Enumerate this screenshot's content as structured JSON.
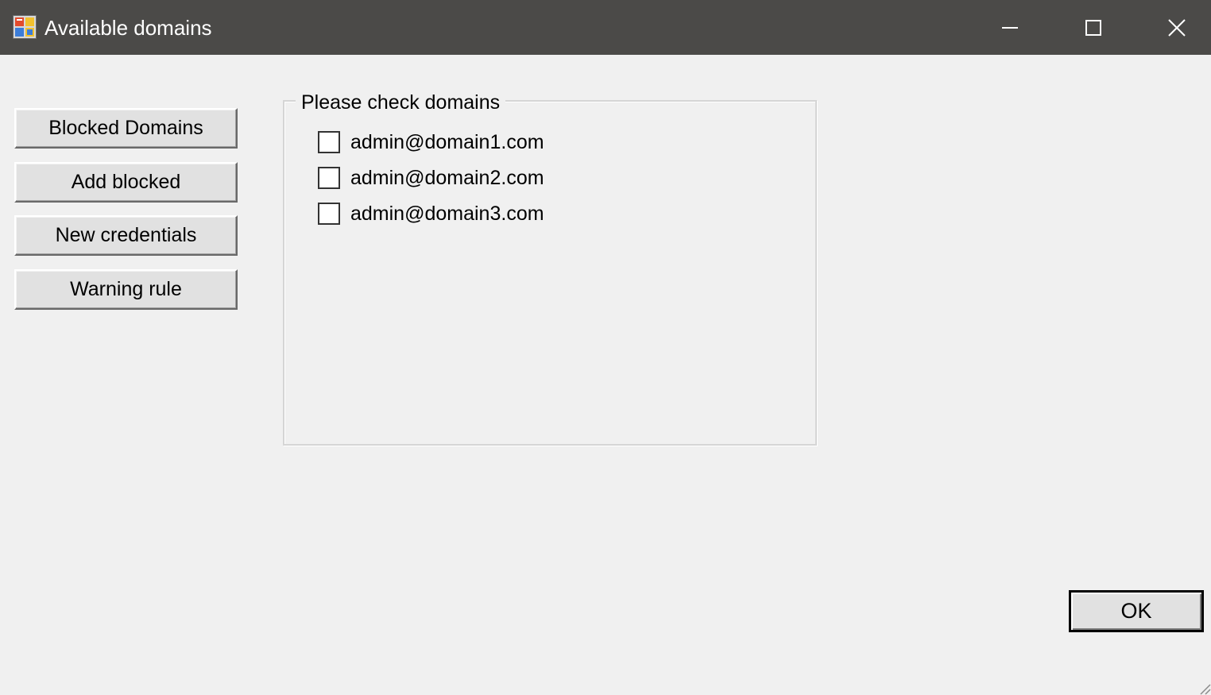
{
  "window": {
    "title": "Available domains"
  },
  "sidebar": {
    "buttons": [
      {
        "label": "Blocked Domains"
      },
      {
        "label": "Add blocked"
      },
      {
        "label": "New credentials"
      },
      {
        "label": "Warning rule"
      }
    ]
  },
  "domains_group": {
    "title": "Please check domains",
    "items": [
      {
        "label": "admin@domain1.com",
        "checked": false
      },
      {
        "label": "admin@domain2.com",
        "checked": false
      },
      {
        "label": "admin@domain3.com",
        "checked": false
      }
    ]
  },
  "footer": {
    "ok_label": "OK"
  },
  "icons": {
    "app": "app-form-icon",
    "minimize": "minimize-icon",
    "maximize": "maximize-icon",
    "close": "close-icon",
    "resize": "resize-grip-icon"
  },
  "colors": {
    "titlebar": "#4b4a48",
    "background": "#f0f0f0",
    "button_face": "#e1e1e1"
  }
}
